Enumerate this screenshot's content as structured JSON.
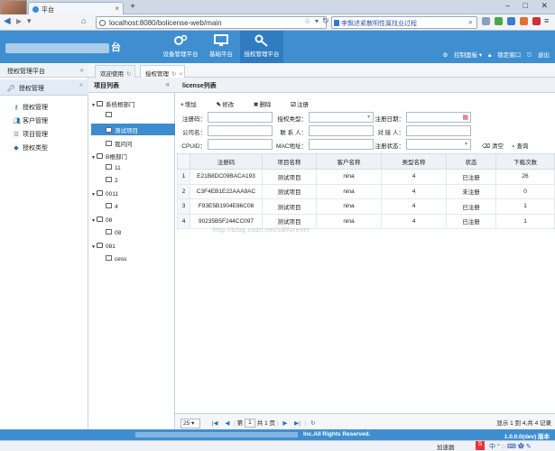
{
  "browser": {
    "tab_title": "平台",
    "url": "localhost:8080/bolicense-web/main",
    "search_text": "李飘述紧散明性属找业过程",
    "new_tab": "+",
    "window_controls": "– □ ✕"
  },
  "header": {
    "logo_text": "台",
    "nav": [
      {
        "label": "设备管理平台",
        "icon": "gears-icon"
      },
      {
        "label": "基础平台",
        "icon": "monitor-icon"
      },
      {
        "label": "授权管理平台",
        "icon": "key-wrench-icon"
      }
    ],
    "right": {
      "dashboard": "控制面板 ▾",
      "lock": "锁定窗口",
      "logout": "退出"
    }
  },
  "sidebar": {
    "title": "授权管理平台",
    "group": "授权管理",
    "items": [
      {
        "label": "授权管理",
        "icon": "key-icon"
      },
      {
        "label": "客户管理",
        "icon": "users-icon"
      },
      {
        "label": "项目管理",
        "icon": "list-icon"
      },
      {
        "label": "授权类型",
        "icon": "tag-icon"
      }
    ]
  },
  "content_tabs": [
    {
      "label": "欢迎使用"
    },
    {
      "label": "授权管理"
    }
  ],
  "tree": {
    "title": "项目列表",
    "nodes": [
      {
        "label": "系统根部门",
        "type": "folder",
        "level": 0,
        "expanded": true
      },
      {
        "label": "",
        "type": "file",
        "level": 1
      },
      {
        "label": "测试项目",
        "type": "file",
        "level": 1,
        "selected": true
      },
      {
        "label": "我问问",
        "type": "file",
        "level": 1
      },
      {
        "label": "B根部门",
        "type": "folder",
        "level": 0,
        "expanded": true
      },
      {
        "label": "11",
        "type": "file",
        "level": 1
      },
      {
        "label": "2",
        "type": "file",
        "level": 1
      },
      {
        "label": "0011",
        "type": "folder",
        "level": 0,
        "expanded": true
      },
      {
        "label": "4",
        "type": "file",
        "level": 1
      },
      {
        "label": "08",
        "type": "folder",
        "level": 0,
        "expanded": true
      },
      {
        "label": "08",
        "type": "file",
        "level": 1
      },
      {
        "label": "081",
        "type": "folder",
        "level": 0,
        "expanded": true
      },
      {
        "label": "cess",
        "type": "file",
        "level": 1
      }
    ]
  },
  "list": {
    "title": "license列表",
    "toolbar": {
      "add": "增加",
      "edit": "修改",
      "delete": "删除",
      "register": "注册"
    },
    "form": {
      "reg_code": "注册码：",
      "auth_type": "授权类型：",
      "reg_date": "注册日期：",
      "company": "公司名：",
      "contact": "联 系 人：",
      "receiver": "对 接 人：",
      "cpuid": "CPUID：",
      "mac": "MAC地址：",
      "reg_status": "注册状态：",
      "clear": "清空",
      "query": "查询"
    },
    "columns": [
      "注册码",
      "项目名称",
      "客户名称",
      "类型名称",
      "状态",
      "下载次数"
    ],
    "rows": [
      {
        "n": "1",
        "code": "E21B8DC09BACA193",
        "project": "测试项目",
        "customer": "nina",
        "type": "4",
        "status": "已注册",
        "downloads": "26"
      },
      {
        "n": "2",
        "code": "C3F4EB1E22AAA9AC",
        "project": "测试项目",
        "customer": "nina",
        "type": "4",
        "status": "未注册",
        "downloads": "0"
      },
      {
        "n": "3",
        "code": "F93E5B1904E86C08",
        "project": "测试项目",
        "customer": "nina",
        "type": "4",
        "status": "已注册",
        "downloads": "1"
      },
      {
        "n": "4",
        "code": "90235B5F244CC097",
        "project": "测试项目",
        "customer": "nina",
        "type": "4",
        "status": "已注册",
        "downloads": "1"
      }
    ],
    "watermark": "http://blog.csdn.net/sdlforever"
  },
  "pager": {
    "page_size": "25",
    "page_label": "第",
    "page": "1",
    "total_pages": "共 1 页",
    "info": "显示 1 到 4,共 4 记录"
  },
  "footer": {
    "rights": "Inc.All Rights Reserved.",
    "version": "1.0.0.0(dev) 版本"
  },
  "statusbar": {
    "addons": "加速器"
  }
}
